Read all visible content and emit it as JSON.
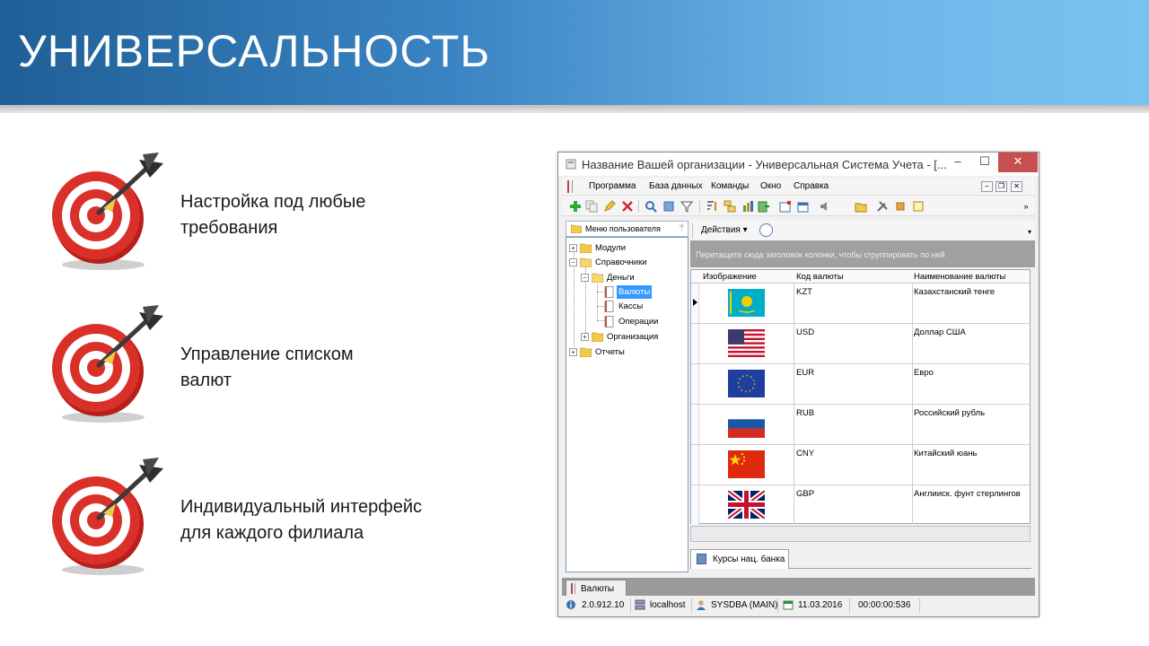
{
  "slide": {
    "title": "УНИВЕРСАЛЬНОСТЬ",
    "bullets": [
      {
        "line1": "Настройка под любые",
        "line2": "требования"
      },
      {
        "line1": "Управление списком",
        "line2": "валют"
      },
      {
        "line1": "Индивидуальный интерфейс",
        "line2": "для каждого филиала"
      }
    ]
  },
  "window": {
    "title": "Название Вашей организации - Универсальная Система Учета - [...",
    "controls": {
      "minimize": "–",
      "maximize": "☐",
      "close": "✕"
    },
    "menu": [
      "Программа",
      "База данных",
      "Команды",
      "Окно",
      "Справка"
    ],
    "mdi_controls": {
      "minimize": "–",
      "restore": "❐",
      "close": "✕"
    }
  },
  "left_panel": {
    "header": "Меню пользователя",
    "pin": "ᛘ",
    "tree": {
      "modules": "Модули",
      "references": "Справочники",
      "money": "Деньги",
      "currencies": "Валюты",
      "cash": "Кассы",
      "operations": "Операции",
      "organization": "Организация",
      "reports": "Отчеты",
      "expand": "+",
      "collapse": "−"
    }
  },
  "right_panel": {
    "actions_label": "Действия ▾",
    "group_hint": "Перетащите сюда заголовок колонки, чтобы сгруппировать по ней",
    "columns": [
      "Изображение",
      "Код валюты",
      "Наименование валюты"
    ],
    "rows": [
      {
        "flag": "kz-flag-icon",
        "code": "KZT",
        "name": "Казахстанский тенге"
      },
      {
        "flag": "us-flag-icon",
        "code": "USD",
        "name": "Доллар США"
      },
      {
        "flag": "eu-flag-icon",
        "code": "EUR",
        "name": "Евро"
      },
      {
        "flag": "ru-flag-icon",
        "code": "RUB",
        "name": "Российский рубль"
      },
      {
        "flag": "cn-flag-icon",
        "code": "CNY",
        "name": "Китайский юань"
      },
      {
        "flag": "gb-flag-icon",
        "code": "GBP",
        "name": "Англииск. фунт стерлингов"
      }
    ],
    "detail_tab": "Курсы нац. банка"
  },
  "mdi_tab": "Валюты",
  "status": {
    "version": "2.0.912.10",
    "host": "localhost",
    "user": "SYSDBA (MAIN)",
    "date": "11.03.2016",
    "timer": "00:00:00:536"
  },
  "colors": {
    "banner_dark": "#1f5f97",
    "banner_light": "#78c2f0",
    "selection": "#3399ff",
    "target_red": "#d42a23",
    "close_button": "#c74f4f"
  }
}
